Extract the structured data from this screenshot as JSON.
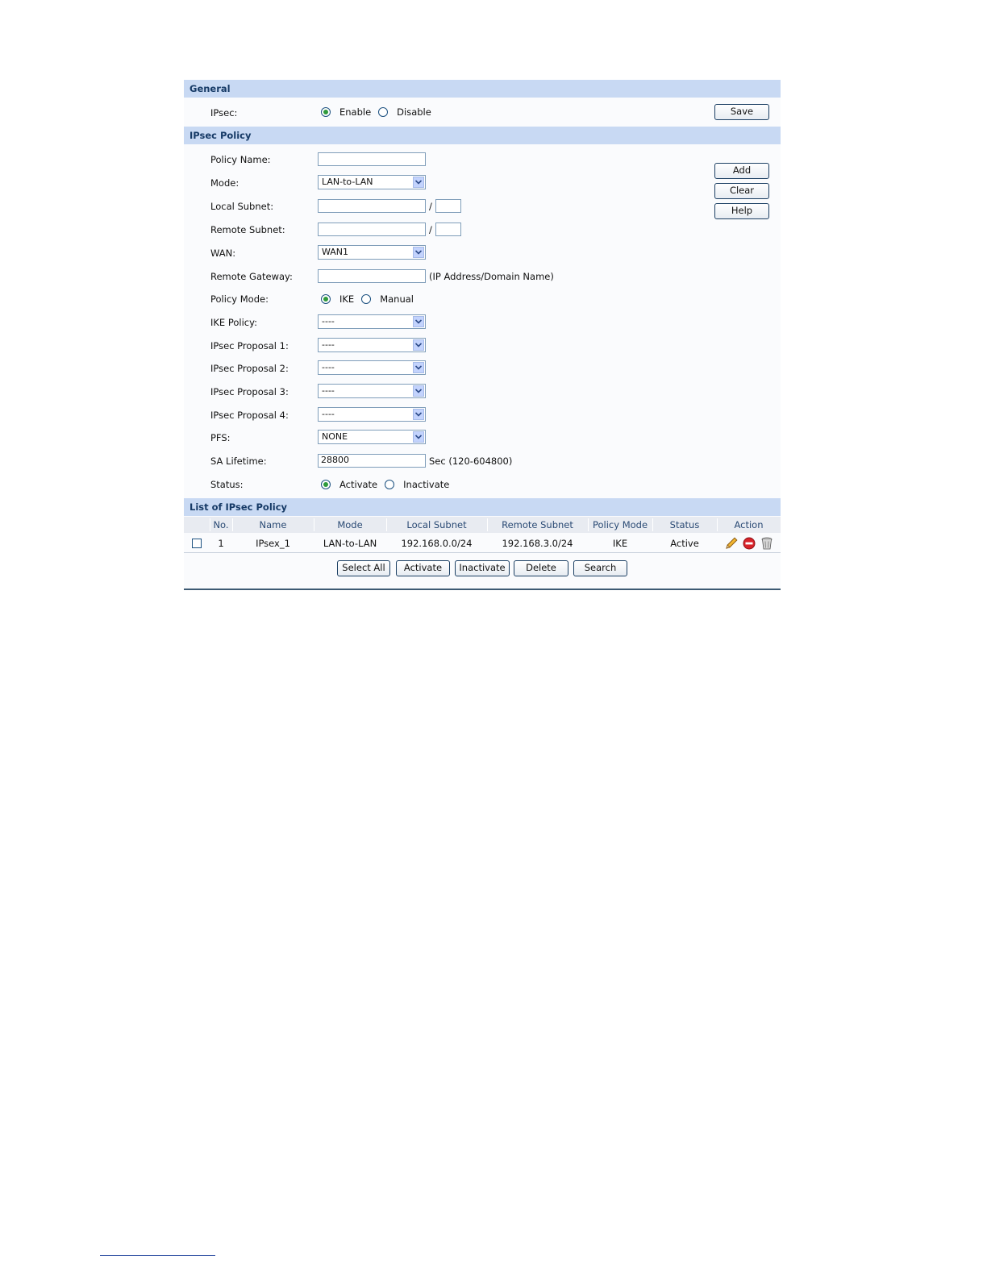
{
  "general": {
    "section_title": "General",
    "ipsec_label": "IPsec:",
    "enable_label": "Enable",
    "disable_label": "Disable",
    "save_label": "Save"
  },
  "policy": {
    "section_title": "IPsec Policy",
    "policy_name_label": "Policy Name:",
    "policy_name_value": "",
    "mode_label": "Mode:",
    "mode_value": "LAN-to-LAN",
    "local_subnet_label": "Local Subnet:",
    "remote_subnet_label": "Remote Subnet:",
    "slash": "/",
    "wan_label": "WAN:",
    "wan_value": "WAN1",
    "remote_gateway_label": "Remote Gateway:",
    "remote_gateway_hint": "(IP Address/Domain Name)",
    "policy_mode_label": "Policy Mode:",
    "ike_label": "IKE",
    "manual_label": "Manual",
    "ike_policy_label": "IKE Policy:",
    "ike_policy_value": "----",
    "proposal1_label": "IPsec Proposal 1:",
    "proposal1_value": "----",
    "proposal2_label": "IPsec Proposal 2:",
    "proposal2_value": "----",
    "proposal3_label": "IPsec Proposal 3:",
    "proposal3_value": "----",
    "proposal4_label": "IPsec Proposal 4:",
    "proposal4_value": "----",
    "pfs_label": "PFS:",
    "pfs_value": "NONE",
    "sa_lifetime_label": "SA Lifetime:",
    "sa_lifetime_value": "28800",
    "sa_lifetime_hint": "Sec (120-604800)",
    "status_label": "Status:",
    "activate_label": "Activate",
    "inactivate_label": "Inactivate",
    "add_label": "Add",
    "clear_label": "Clear",
    "help_label": "Help"
  },
  "list": {
    "section_title": "List of IPsec Policy",
    "headers": [
      "No.",
      "Name",
      "Mode",
      "Local Subnet",
      "Remote Subnet",
      "Policy Mode",
      "Status",
      "Action"
    ],
    "rows": [
      [
        "1",
        "IPsex_1",
        "LAN-to-LAN",
        "192.168.0.0/24",
        "192.168.3.0/24",
        "IKE",
        "Active"
      ]
    ],
    "buttons": {
      "select_all": "Select All",
      "activate": "Activate",
      "inactivate": "Inactivate",
      "delete": "Delete",
      "search": "Search"
    }
  },
  "colors": {
    "section_header_bg": "#c8d9f3",
    "section_header_text": "#163a66",
    "radio_selected": "#2f9a3c"
  },
  "icons": [
    "edit-pencil-icon",
    "disable-icon",
    "trash-icon",
    "dropdown-arrow-icon"
  ]
}
